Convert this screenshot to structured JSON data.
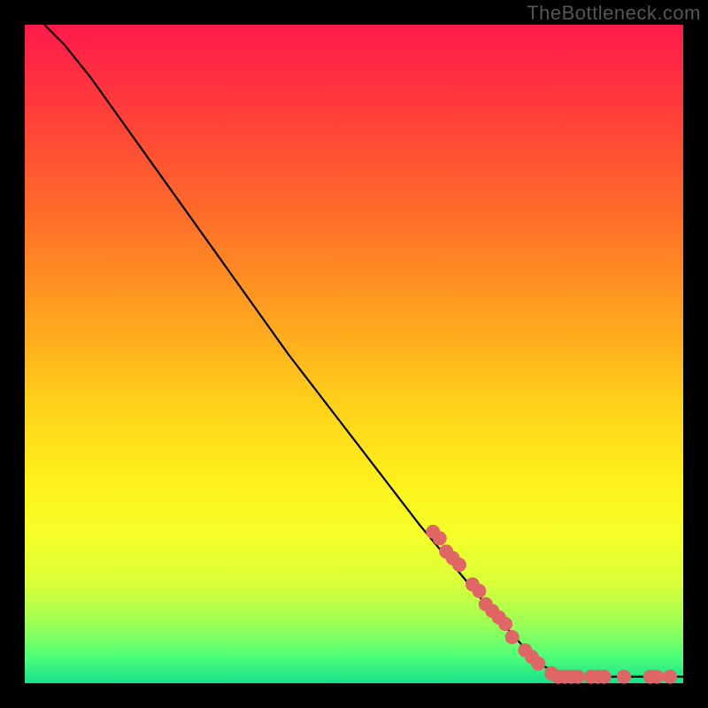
{
  "watermark": "TheBottleneck.com",
  "chart_data": {
    "type": "line",
    "title": "",
    "xlabel": "",
    "ylabel": "",
    "xlim": [
      0,
      100
    ],
    "ylim": [
      0,
      100
    ],
    "grid": false,
    "legend": false,
    "curve": {
      "name": "bottleneck-curve",
      "color": "#000000",
      "points": [
        {
          "x": 3,
          "y": 100
        },
        {
          "x": 6,
          "y": 97
        },
        {
          "x": 10,
          "y": 92
        },
        {
          "x": 15,
          "y": 85
        },
        {
          "x": 20,
          "y": 78
        },
        {
          "x": 30,
          "y": 64
        },
        {
          "x": 40,
          "y": 50
        },
        {
          "x": 50,
          "y": 37
        },
        {
          "x": 60,
          "y": 24
        },
        {
          "x": 70,
          "y": 12
        },
        {
          "x": 78,
          "y": 3
        },
        {
          "x": 82,
          "y": 1
        },
        {
          "x": 88,
          "y": 1
        },
        {
          "x": 95,
          "y": 1
        },
        {
          "x": 100,
          "y": 1
        }
      ]
    },
    "markers": {
      "name": "highlighted-points",
      "color": "#e06666",
      "radius": 8,
      "points": [
        {
          "x": 62,
          "y": 23
        },
        {
          "x": 63,
          "y": 22
        },
        {
          "x": 64,
          "y": 20
        },
        {
          "x": 65,
          "y": 19
        },
        {
          "x": 66,
          "y": 18
        },
        {
          "x": 68,
          "y": 15
        },
        {
          "x": 69,
          "y": 14
        },
        {
          "x": 70,
          "y": 12
        },
        {
          "x": 71,
          "y": 11
        },
        {
          "x": 72,
          "y": 10
        },
        {
          "x": 73,
          "y": 9
        },
        {
          "x": 74,
          "y": 7
        },
        {
          "x": 76,
          "y": 5
        },
        {
          "x": 77,
          "y": 4
        },
        {
          "x": 78,
          "y": 3
        },
        {
          "x": 80,
          "y": 1.5
        },
        {
          "x": 81,
          "y": 1
        },
        {
          "x": 82,
          "y": 1
        },
        {
          "x": 83,
          "y": 1
        },
        {
          "x": 84,
          "y": 1
        },
        {
          "x": 86,
          "y": 1
        },
        {
          "x": 87,
          "y": 1
        },
        {
          "x": 88,
          "y": 1
        },
        {
          "x": 91,
          "y": 1
        },
        {
          "x": 95,
          "y": 1
        },
        {
          "x": 96,
          "y": 1
        },
        {
          "x": 98,
          "y": 1
        }
      ]
    }
  }
}
